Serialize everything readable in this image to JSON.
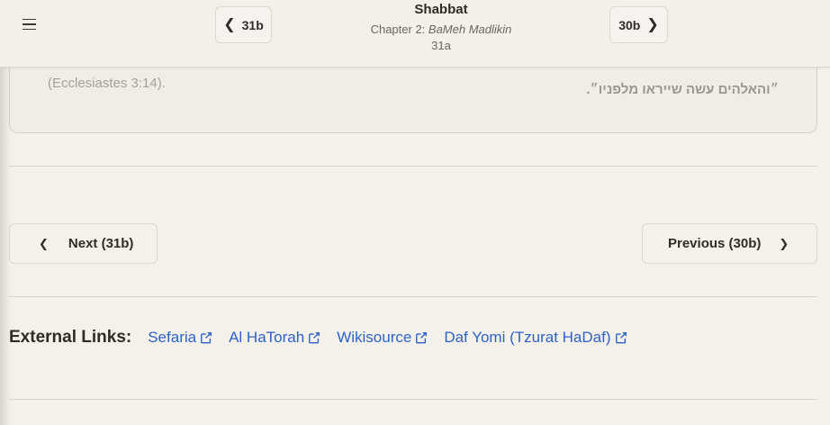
{
  "header": {
    "menu_icon": "hamburger-menu-icon",
    "prev_daf_label": "31b",
    "next_daf_label": "30b",
    "book_title": "Shabbat",
    "chapter_prefix": "Chapter 2: ",
    "chapter_name": "BaMeh Madlikin",
    "current_daf": "31a"
  },
  "quote": {
    "english_ref": "(Ecclesiastes 3:14).",
    "hebrew": "״והאלהים עשה שייראו מלפניו״."
  },
  "pagination": {
    "next_label": "Next (31b)",
    "previous_label": "Previous (30b)"
  },
  "external_links": {
    "label": "External Links:",
    "links": [
      "Sefaria",
      "Al HaTorah",
      "Wikisource",
      "Daf Yomi (Tzurat HaDaf)"
    ],
    "link_color": "#2d62c8",
    "icon": "external-link-icon"
  }
}
